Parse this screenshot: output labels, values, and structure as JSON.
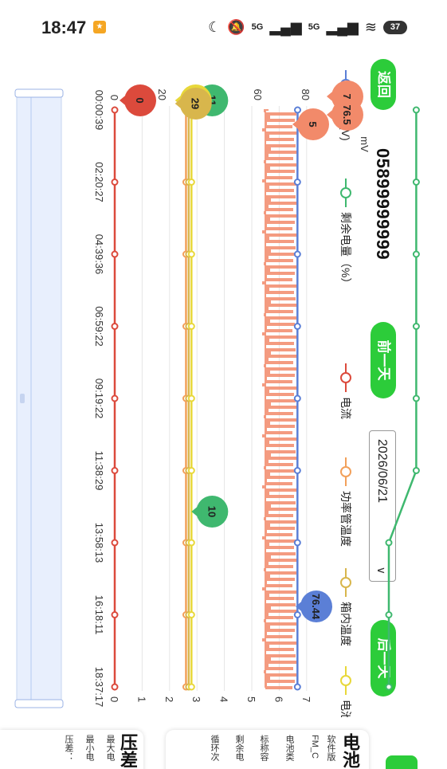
{
  "status": {
    "time": "18:47",
    "battery": "37",
    "sig1": "5G",
    "sig2": "5G"
  },
  "header": {
    "back_label": "返回",
    "device_id": "05899999999",
    "prev_day_label": "前一天",
    "date": "2026/06/21",
    "next_day_label": "后一天"
  },
  "legend": [
    {
      "label": "电压(V)",
      "color": "#5b7fd6"
    },
    {
      "label": "剩余电量（%）",
      "color": "#3fb86f"
    },
    {
      "label": "电流",
      "color": "#dc4a3c"
    },
    {
      "label": "功率管温度",
      "color": "#f2a05a"
    },
    {
      "label": "箱内温度",
      "color": "#d8b64c"
    },
    {
      "label": "电池温度",
      "color": "#e8d83a"
    }
  ],
  "chart_data": {
    "type": "line",
    "x": [
      "00:00:39",
      "02:20:27",
      "04:39:36",
      "06:59:22",
      "09:19:22",
      "11:38:29",
      "13:58:13",
      "16:18:11",
      "18:37:17"
    ],
    "left_axis": {
      "ticks": [
        "0",
        "20",
        "40",
        "60",
        "80"
      ],
      "ylabel_fragment": "mV"
    },
    "right_axis": {
      "ticks": [
        "0",
        "1",
        "2",
        "3",
        "4",
        "5",
        "6",
        "7"
      ]
    },
    "series": [
      {
        "name": "电压(V)",
        "color": "#5b7fd6",
        "values": [
          76.5,
          76.44,
          76.44,
          76.44,
          76.44,
          76.44,
          76.44,
          76.44,
          76.44
        ]
      },
      {
        "name": "剩余电量（%）",
        "color": "#3fb86f",
        "values": [
          11,
          11,
          11,
          11,
          11,
          11,
          10,
          10,
          10
        ]
      },
      {
        "name": "电流",
        "color": "#dc4a3c",
        "values": [
          0,
          0,
          0,
          0,
          0,
          0,
          0,
          0,
          0
        ]
      },
      {
        "name": "功率管温度",
        "color": "#f2a05a",
        "values": [
          29,
          29,
          29,
          29,
          29,
          29,
          29,
          29,
          29
        ]
      },
      {
        "name": "箱内温度",
        "color": "#d8b64c",
        "values": [
          29,
          29,
          29,
          29,
          29,
          29,
          29,
          29,
          29
        ]
      },
      {
        "name": "电池温度",
        "color": "#e8d83a",
        "values": [
          29,
          29,
          29,
          29,
          29,
          29,
          29,
          29,
          29
        ]
      }
    ],
    "markers": [
      {
        "label": "7",
        "color": "#f28a6a"
      },
      {
        "label": "76.5",
        "color": "#f28a6a"
      },
      {
        "label": "5",
        "color": "#f28a6a"
      },
      {
        "label": "76.44",
        "color": "#5b7fd6"
      },
      {
        "label": "11",
        "color": "#3fb86f"
      },
      {
        "label": "10",
        "color": "#3fb86f"
      },
      {
        "label": "0",
        "color": "#dc4a3c"
      },
      {
        "label": "29",
        "color": "#e8d83a"
      },
      {
        "label": "29",
        "color": "#d8b64c"
      }
    ],
    "mini_chart": {
      "color": "#bcd0f5"
    }
  },
  "info": {
    "battery_card_title": "电池",
    "battery_card_lines": [
      "软件版",
      "FM_C",
      "电池类",
      "标称容",
      "剩余电",
      "循环次"
    ],
    "pressure_card_title": "压差",
    "pressure_card_lines": [
      "最大电",
      "最小电",
      "压差："
    ]
  }
}
